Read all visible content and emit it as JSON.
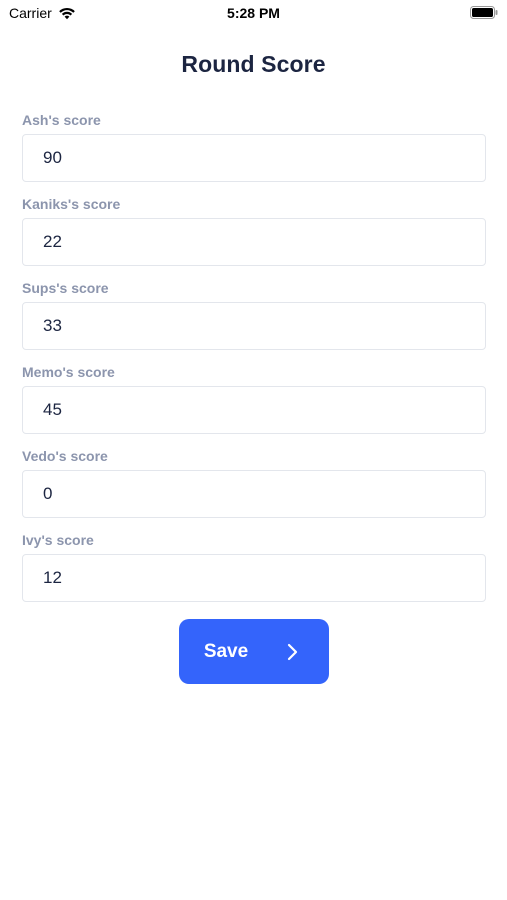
{
  "status_bar": {
    "carrier": "Carrier",
    "time": "5:28 PM"
  },
  "page": {
    "title": "Round Score"
  },
  "fields": [
    {
      "label": "Ash's score",
      "value": "90"
    },
    {
      "label": "Kaniks's score",
      "value": "22"
    },
    {
      "label": "Sups's score",
      "value": "33"
    },
    {
      "label": "Memo's score",
      "value": "45"
    },
    {
      "label": "Vedo's score",
      "value": "0"
    },
    {
      "label": "Ivy's score",
      "value": "12"
    }
  ],
  "save_button": {
    "label": "Save",
    "icon": "chevron-right-icon"
  },
  "colors": {
    "accent": "#3464fb",
    "title": "#1c2541",
    "label": "#8c95ad",
    "border": "#e3e6ec"
  }
}
